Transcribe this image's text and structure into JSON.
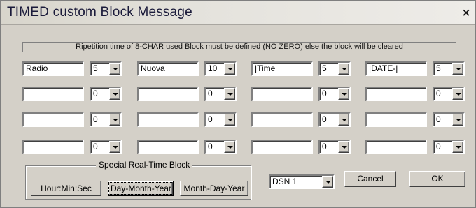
{
  "window": {
    "title": "TIMED custom Block Message",
    "close_icon": "close-icon",
    "close_glyph": "×"
  },
  "notice": "Ripetition time of 8-CHAR used Block must be defined (NO ZERO) else the block will be cleared",
  "blocks": [
    [
      {
        "text": "Radio",
        "repeat": "5"
      },
      {
        "text": "Nuova",
        "repeat": "10"
      },
      {
        "text": "|Time",
        "repeat": "5"
      },
      {
        "text": "|DATE-|",
        "repeat": "5"
      }
    ],
    [
      {
        "text": "",
        "repeat": "0"
      },
      {
        "text": "",
        "repeat": "0"
      },
      {
        "text": "",
        "repeat": "0"
      },
      {
        "text": "",
        "repeat": "0"
      }
    ],
    [
      {
        "text": "",
        "repeat": "0"
      },
      {
        "text": "",
        "repeat": "0"
      },
      {
        "text": "",
        "repeat": "0"
      },
      {
        "text": "",
        "repeat": "0"
      }
    ],
    [
      {
        "text": "",
        "repeat": "0"
      },
      {
        "text": "",
        "repeat": "0"
      },
      {
        "text": "",
        "repeat": "0"
      },
      {
        "text": "",
        "repeat": "0"
      }
    ]
  ],
  "special": {
    "label": "Special Real-Time Block",
    "buttons": [
      "Hour:Min:Sec",
      "Day-Month-Year",
      "Month-Day-Year"
    ]
  },
  "dsn": {
    "selected": "DSN 1"
  },
  "actions": {
    "cancel": "Cancel",
    "ok": "OK"
  }
}
